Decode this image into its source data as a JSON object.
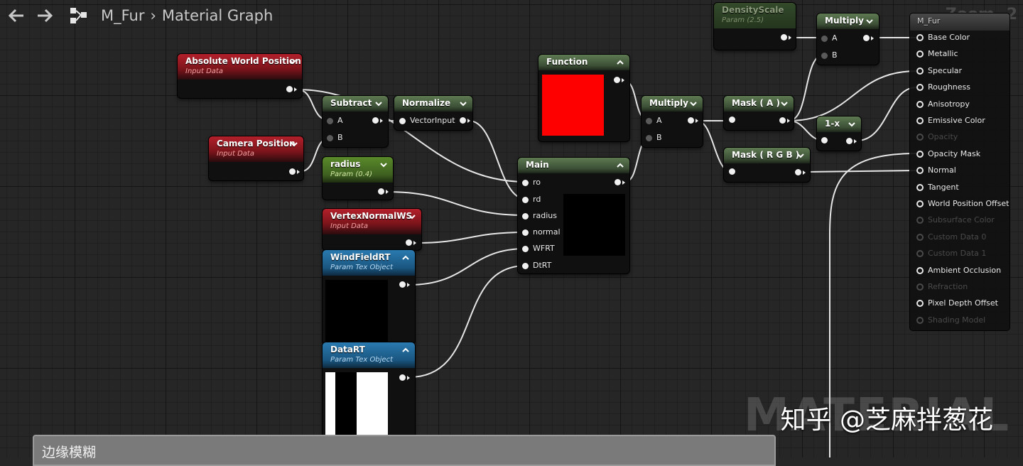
{
  "breadcrumb": {
    "asset": "M_Fur",
    "section": "Material Graph"
  },
  "zoom_label": "Zoom -2",
  "watermark": "MATERIAL",
  "credit": "知乎 @芝麻拌葱花",
  "comment": {
    "label": "边缘模糊"
  },
  "colors": {
    "input_red": "#b3202b",
    "param_blue": "#2a7ab0",
    "param_green": "#5a8a2a",
    "function_preview": "#ff0000"
  },
  "nodes": {
    "abs_world_pos": {
      "title": "Absolute World Position",
      "subtitle": "Input Data"
    },
    "camera_pos": {
      "title": "Camera Position",
      "subtitle": "Input Data"
    },
    "subtract": {
      "title": "Subtract",
      "pin_a": "A",
      "pin_b": "B"
    },
    "normalize": {
      "title": "Normalize",
      "pin_in": "VectorInput"
    },
    "radius": {
      "title": "radius",
      "subtitle": "Param (0.4)"
    },
    "vertex_normal": {
      "title": "VertexNormalWS",
      "subtitle": "Input Data"
    },
    "windfield": {
      "title": "WindFieldRT",
      "subtitle": "Param Tex Object"
    },
    "datart": {
      "title": "DataRT",
      "subtitle": "Param Tex Object"
    },
    "function": {
      "title": "Function"
    },
    "main": {
      "title": "Main",
      "pins": [
        "ro",
        "rd",
        "radius",
        "normal",
        "WFRT",
        "DtRT"
      ]
    },
    "multiply1": {
      "title": "Multiply",
      "pin_a": "A",
      "pin_b": "B"
    },
    "mask_a": {
      "title": "Mask ( A )"
    },
    "mask_rgb": {
      "title": "Mask ( R G B )"
    },
    "one_minus_x": {
      "title": "1-x"
    },
    "density": {
      "title": "DensityScale",
      "subtitle": "Param (2.5)"
    },
    "multiply2": {
      "title": "Multiply",
      "pin_a": "A",
      "pin_b": "B"
    }
  },
  "result": {
    "title": "M_Fur",
    "pins": [
      {
        "label": "Base Color",
        "active": true
      },
      {
        "label": "Metallic",
        "active": true
      },
      {
        "label": "Specular",
        "active": true
      },
      {
        "label": "Roughness",
        "active": true
      },
      {
        "label": "Anisotropy",
        "active": true
      },
      {
        "label": "Emissive Color",
        "active": true
      },
      {
        "label": "Opacity",
        "active": false
      },
      {
        "label": "Opacity Mask",
        "active": true
      },
      {
        "label": "Normal",
        "active": true
      },
      {
        "label": "Tangent",
        "active": true
      },
      {
        "label": "World Position Offset",
        "active": true
      },
      {
        "label": "Subsurface Color",
        "active": false
      },
      {
        "label": "Custom Data 0",
        "active": false
      },
      {
        "label": "Custom Data 1",
        "active": false
      },
      {
        "label": "Ambient Occlusion",
        "active": true
      },
      {
        "label": "Refraction",
        "active": false
      },
      {
        "label": "Pixel Depth Offset",
        "active": true
      },
      {
        "label": "Shading Model",
        "active": false
      }
    ]
  }
}
